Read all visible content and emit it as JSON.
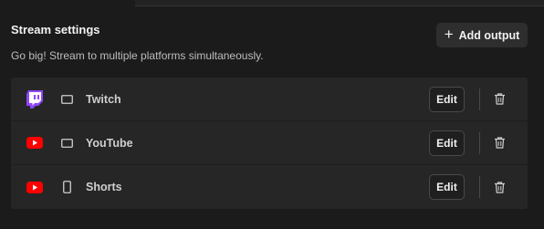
{
  "header": {
    "title": "Stream settings",
    "subtitle": "Go big! Stream to multiple platforms simultaneously.",
    "add_output_label": "Add output",
    "add_output_icon": "plus-icon"
  },
  "outputs": [
    {
      "name": "Twitch",
      "platform_icon": "twitch-icon",
      "device_icon": "landscape-screen-icon",
      "edit_label": "Edit",
      "delete_icon": "trash-icon",
      "brand_color": "#9146ff"
    },
    {
      "name": "YouTube",
      "platform_icon": "youtube-icon",
      "device_icon": "landscape-screen-icon",
      "edit_label": "Edit",
      "delete_icon": "trash-icon",
      "brand_color": "#ff0000"
    },
    {
      "name": "Shorts",
      "platform_icon": "youtube-icon",
      "device_icon": "portrait-phone-icon",
      "edit_label": "Edit",
      "delete_icon": "trash-icon",
      "brand_color": "#ff0000"
    }
  ]
}
